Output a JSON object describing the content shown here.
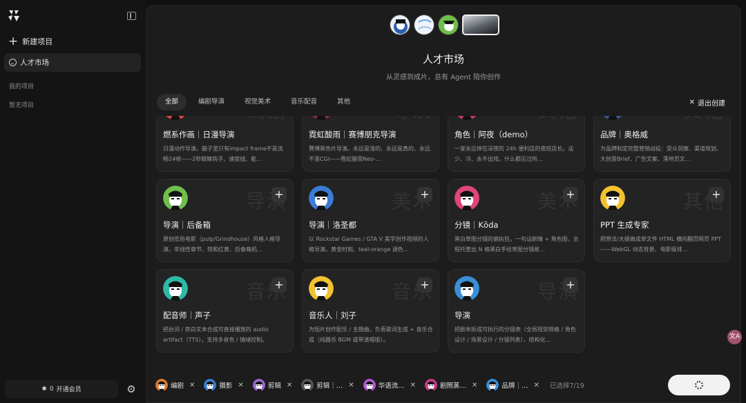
{
  "sidebar": {
    "new_project": "新建项目",
    "talent_market": "人才市场",
    "my_projects": "我的项目",
    "no_projects": "暂无项目",
    "vip_count": "0",
    "vip_label": "开通会员"
  },
  "header": {
    "title": "人才市场",
    "subtitle": "从灵感到成片，总有 Agent 陪你创作"
  },
  "tabs": [
    "全部",
    "编剧导演",
    "视觉美术",
    "音乐配音",
    "其他"
  ],
  "exit_label": "退出创建",
  "cards": [
    {
      "name": "燃系作画｜日漫导演",
      "desc": "日漫动作导演。脑子里只有impact frame不是流畅24帧——2秒眼睛钩子、速度线、能…",
      "bg": "编剧",
      "avatar_color": "#d94a4a"
    },
    {
      "name": "霓虹酸雨｜赛博朋克导演",
      "desc": "赛博黑色片导演。永远是湿的、永远是真的、永远不准CGI——霓虹酸雨Neo-…",
      "bg": "导演",
      "avatar_color": "#7a2a4a"
    },
    {
      "name": "角色｜阿夜（demo）",
      "desc": "一家永远停在深夜的 24h 便利店的夜班店长。话少、冷、永不出戏，什么都见过所…",
      "bg": "其他",
      "avatar_color": "#c83a6a"
    },
    {
      "name": "品牌｜奥格威",
      "desc": "为品牌制定完整营销战役：受众洞察、渠道规划、大创意Brief、广告文案、落地页文…",
      "bg": "其他",
      "avatar_color": "#3a5a8a"
    },
    {
      "name": "导演｜后备箱",
      "desc": "原创低俗电影（pulp/Grindhouse）风格人格导演。非线性章节、饱和红黄、后备箱机…",
      "bg": "导演",
      "avatar_color": "#6fbf4a"
    },
    {
      "name": "导演｜洛圣都",
      "desc": "以 Rockstar Games / GTA V 美学创作视频的人格导演。黄金时刻、teal-orange 调色…",
      "bg": "美术",
      "avatar_color": "#3a7bd5"
    },
    {
      "name": "分镜｜Kōda",
      "desc": "黑白草图分镜的偏执狂。一句话剧情 + 角色图，全程托管出 N 格黑白手绘草图分镜故…",
      "bg": "美术",
      "avatar_color": "#e0457b"
    },
    {
      "name": "PPT 生成专家",
      "desc": "把想法/大纲做成单文件 HTML 横向翻页网页 PPT——WebGL 动态背景、电影级排…",
      "bg": "其他",
      "avatar_color": "#f2c230"
    },
    {
      "name": "配音师｜声子",
      "desc": "把台词 / 旁白文本合成可直接播放的 audio artifact（TTS）。支持多音色 / 情绪控制。",
      "bg": "音乐",
      "avatar_color": "#2fb8a8"
    },
    {
      "name": "音乐人｜刘子",
      "desc": "为短片创作配乐 / 主题曲。负责歌词生成 + 音乐合成（纯器乐 BGM 或带演唱版）。",
      "bg": "音乐",
      "avatar_color": "#f2c230"
    },
    {
      "name": "导演",
      "desc": "把剧本拆成可执行的分镜表（全局视觉规格 / 角色设计 / 场景设计 / 分镜列表），结构化…",
      "bg": "导演",
      "avatar_color": "#3a8fd5"
    }
  ],
  "selected_chips": [
    {
      "label": "编剧",
      "color": "#e07a2a"
    },
    {
      "label": "摄影",
      "color": "#3a7bd5"
    },
    {
      "label": "剪辑",
      "color": "#9a6ad5"
    },
    {
      "label": "剪辑｜…",
      "color": "#555555"
    },
    {
      "label": "华语流…",
      "color": "#b05ad5"
    },
    {
      "label": "剧照蒸…",
      "color": "#c83a8a"
    },
    {
      "label": "品牌｜…",
      "color": "#3a8fd5"
    }
  ],
  "selected_count": "已选择7/19"
}
